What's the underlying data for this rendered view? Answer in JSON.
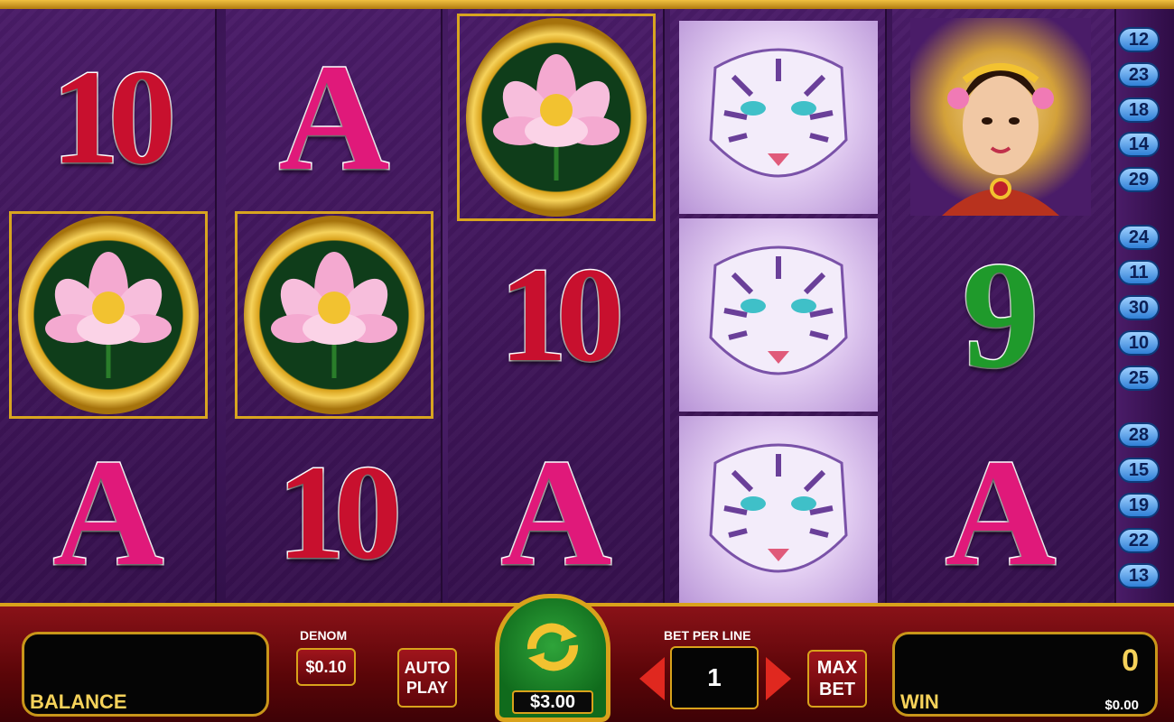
{
  "game": {
    "reels": [
      [
        "10",
        "lotus",
        "A"
      ],
      [
        "A",
        "lotus",
        "10"
      ],
      [
        "lotus",
        "10",
        "A"
      ],
      [
        "white-tiger",
        "white-tiger",
        "white-tiger"
      ],
      [
        "princess",
        "9",
        "A"
      ]
    ],
    "paylines": [
      "12",
      "23",
      "18",
      "14",
      "29",
      "24",
      "11",
      "30",
      "10",
      "25",
      "28",
      "15",
      "19",
      "22",
      "13"
    ]
  },
  "controls": {
    "balance_label": "BALANCE",
    "balance_value": "",
    "denom_label": "DENOM",
    "denom_value": "$0.10",
    "auto_play_label_1": "AUTO",
    "auto_play_label_2": "PLAY",
    "spin_bet": "$3.00",
    "bet_per_line_label": "BET PER LINE",
    "bet_per_line_value": "1",
    "max_bet_label_1": "MAX",
    "max_bet_label_2": "BET",
    "win_label": "WIN",
    "win_credits": "0",
    "win_amount": "$0.00"
  },
  "symbols": {
    "ten": "10",
    "ace": "A",
    "nine": "9"
  },
  "colors": {
    "ten": "#c8102e",
    "ace": "#e0197a",
    "nine": "#1f9a2b",
    "gold": "#d9a21b",
    "panel_bg": "#050505"
  }
}
